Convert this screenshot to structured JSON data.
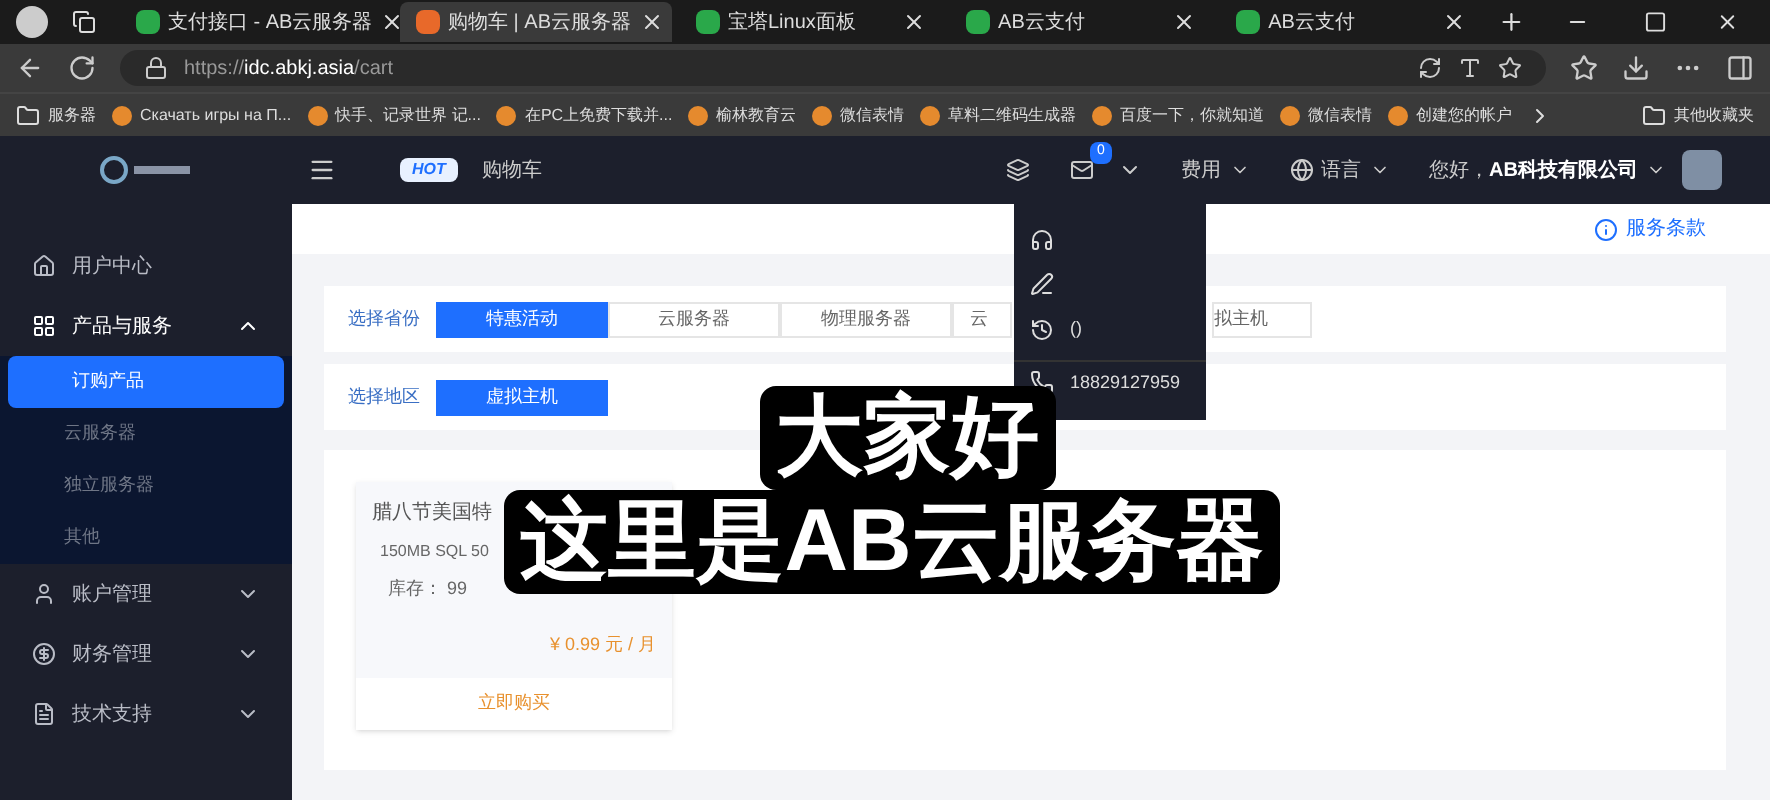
{
  "browser": {
    "tabs": [
      {
        "title": "支付接口 - AB云服务器",
        "selected": false
      },
      {
        "title": "购物车 | AB云服务器",
        "selected": true
      },
      {
        "title": "宝塔Linux面板",
        "selected": false
      },
      {
        "title": "AB云支付",
        "selected": false
      },
      {
        "title": "AB云支付",
        "selected": false
      }
    ],
    "url_host": "idc.abkj.asia",
    "url_scheme": "https://",
    "url_path": "/cart",
    "bookmarks": [
      {
        "label": "服务器",
        "kind": "folder"
      },
      {
        "label": "Скачать игры на П...",
        "kind": "site"
      },
      {
        "label": "快手、记录世界 记...",
        "kind": "site"
      },
      {
        "label": "在PC上免费下载并...",
        "kind": "site"
      },
      {
        "label": "榆林教育云",
        "kind": "site"
      },
      {
        "label": "微信表情",
        "kind": "site"
      },
      {
        "label": "草料二维码生成器",
        "kind": "site"
      },
      {
        "label": "百度一下，你就知道",
        "kind": "site"
      },
      {
        "label": "微信表情",
        "kind": "site"
      },
      {
        "label": "创建您的帐户",
        "kind": "site"
      }
    ],
    "other_bookmarks": "其他收藏夹"
  },
  "header": {
    "hot_badge": "HOT",
    "cart": "购物车",
    "message_count": "0",
    "fees": "费用",
    "language": "语言",
    "greeting": "您好，",
    "company": "AB科技有限公司"
  },
  "dropdown": {
    "items": [
      {
        "kind": "support"
      },
      {
        "kind": "edit"
      },
      {
        "kind": "history",
        "text": "()"
      },
      {
        "kind": "phone",
        "text": "18829127959"
      }
    ]
  },
  "sidebar": {
    "items": [
      {
        "label": "用户中心",
        "kind": "home",
        "expanded": false
      },
      {
        "label": "产品与服务",
        "kind": "grid",
        "expanded": true,
        "children": [
          {
            "label": "订购产品",
            "selected": true
          },
          {
            "label": "云服务器",
            "selected": false
          },
          {
            "label": "独立服务器",
            "selected": false
          },
          {
            "label": "其他",
            "selected": false
          }
        ]
      },
      {
        "label": "账户管理",
        "kind": "user",
        "expanded": false
      },
      {
        "label": "财务管理",
        "kind": "money",
        "expanded": false
      },
      {
        "label": "技术支持",
        "kind": "doc",
        "expanded": false
      }
    ]
  },
  "terms_link": "服务条款",
  "filters": [
    {
      "label": "选择省份",
      "options": [
        {
          "label": "特惠活动",
          "selected": true
        },
        {
          "label": "云服务器",
          "selected": false
        },
        {
          "label": "物理服务器",
          "selected": false
        },
        {
          "label": "云",
          "selected": false
        },
        {
          "label": "拟主机",
          "selected": false
        }
      ]
    },
    {
      "label": "选择地区",
      "options": [
        {
          "label": "虚拟主机",
          "selected": true
        }
      ]
    }
  ],
  "product": {
    "name": "腊八节美国特",
    "spec": "150MB SQL 50",
    "stock": "库存： 99",
    "price": "¥ 0.99 元 / 月",
    "buy": "立即购买"
  },
  "captions": [
    "大家好",
    "这里是AB云服务器"
  ]
}
